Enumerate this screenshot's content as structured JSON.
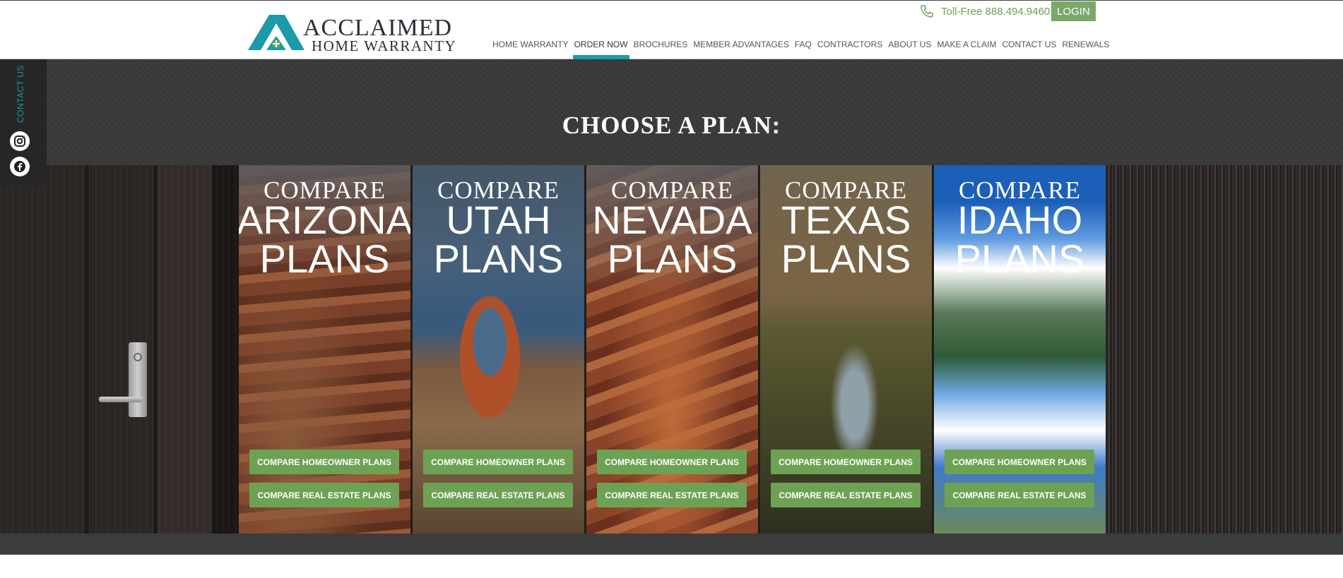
{
  "header": {
    "logo": {
      "line1": "ACCLAIMED",
      "line2": "HOME WARRANTY"
    },
    "tollfree": "Toll-Free 888.494.9460",
    "login_label": "LOGIN",
    "nav": [
      {
        "label": "HOME WARRANTY",
        "active": false
      },
      {
        "label": "ORDER NOW",
        "active": true
      },
      {
        "label": "BROCHURES",
        "active": false
      },
      {
        "label": "MEMBER ADVANTAGES",
        "active": false
      },
      {
        "label": "FAQ",
        "active": false
      },
      {
        "label": "CONTRACTORS",
        "active": false
      },
      {
        "label": "ABOUT US",
        "active": false
      },
      {
        "label": "MAKE A CLAIM",
        "active": false
      },
      {
        "label": "CONTACT US",
        "active": false
      },
      {
        "label": "RENEWALS",
        "active": false
      }
    ]
  },
  "side_tab": {
    "label": "CONTACT US",
    "icons": [
      "instagram-icon",
      "facebook-icon"
    ]
  },
  "main": {
    "heading": "CHOOSE A PLAN:",
    "panels": [
      {
        "compare": "COMPARE",
        "state": "ARIZONA",
        "plans": "PLANS",
        "btn_home": "COMPARE HOMEOWNER PLANS",
        "btn_real": "COMPARE REAL ESTATE PLANS"
      },
      {
        "compare": "COMPARE",
        "state": "UTAH",
        "plans": "PLANS",
        "btn_home": "COMPARE HOMEOWNER PLANS",
        "btn_real": "COMPARE REAL ESTATE PLANS"
      },
      {
        "compare": "COMPARE",
        "state": "NEVADA",
        "plans": "PLANS",
        "btn_home": "COMPARE HOMEOWNER PLANS",
        "btn_real": "COMPARE REAL ESTATE PLANS"
      },
      {
        "compare": "COMPARE",
        "state": "TEXAS",
        "plans": "PLANS",
        "btn_home": "COMPARE HOMEOWNER PLANS",
        "btn_real": "COMPARE REAL ESTATE PLANS"
      },
      {
        "compare": "COMPARE",
        "state": "IDAHO",
        "plans": "PLANS",
        "btn_home": "COMPARE HOMEOWNER PLANS",
        "btn_real": "COMPARE REAL ESTATE PLANS"
      }
    ]
  },
  "colors": {
    "accent_teal": "#1b9aaa",
    "button_green": "#6da254",
    "login_green": "#7aa86a",
    "phone_green": "#6aa055"
  }
}
